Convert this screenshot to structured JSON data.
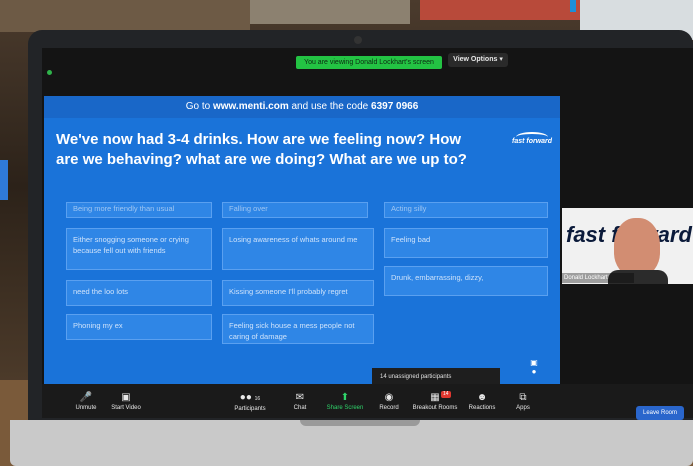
{
  "zoom": {
    "share_banner": "You are viewing Donald Lockhart's screen",
    "view_options": "View Options",
    "self_view_name": "Donald Lockhart",
    "self_view_text": "fast forward",
    "unassigned": "14 unassigned participants",
    "leave_label": "Leave Room",
    "toolbar": {
      "unmute": "Unmute",
      "start_video": "Start Video",
      "participants": "Participants",
      "participants_count": "16",
      "chat": "Chat",
      "share_screen": "Share Screen",
      "record": "Record",
      "breakout_rooms": "Breakout Rooms",
      "breakout_badge": "14",
      "reactions": "Reactions",
      "apps": "Apps"
    }
  },
  "slide": {
    "menti_prefix": "Go to",
    "menti_site": "www.menti.com",
    "menti_mid": "and use the code",
    "menti_code": "6397 0966",
    "title": "We've now had 3-4 drinks. How are we feeling now? How are we behaving? what are we doing? What are we up to?",
    "logo": "fast forward",
    "responses": [
      "Being more friendly than usual",
      "Falling over",
      "Acting silly",
      "Either snogging someone or crying because fell out with friends",
      "Losing awareness of whats around me",
      "Feeling bad",
      "need the loo lots",
      "Kissing someone I'll probably regret",
      "Drunk, embarrassing, dizzy,",
      "Phoning my ex",
      "Feeling sick house a mess people not caring of damage"
    ]
  },
  "colors": {
    "slide_blue": "#1a73d9",
    "banner_green": "#23c343",
    "leave_blue": "#2a66cc"
  }
}
